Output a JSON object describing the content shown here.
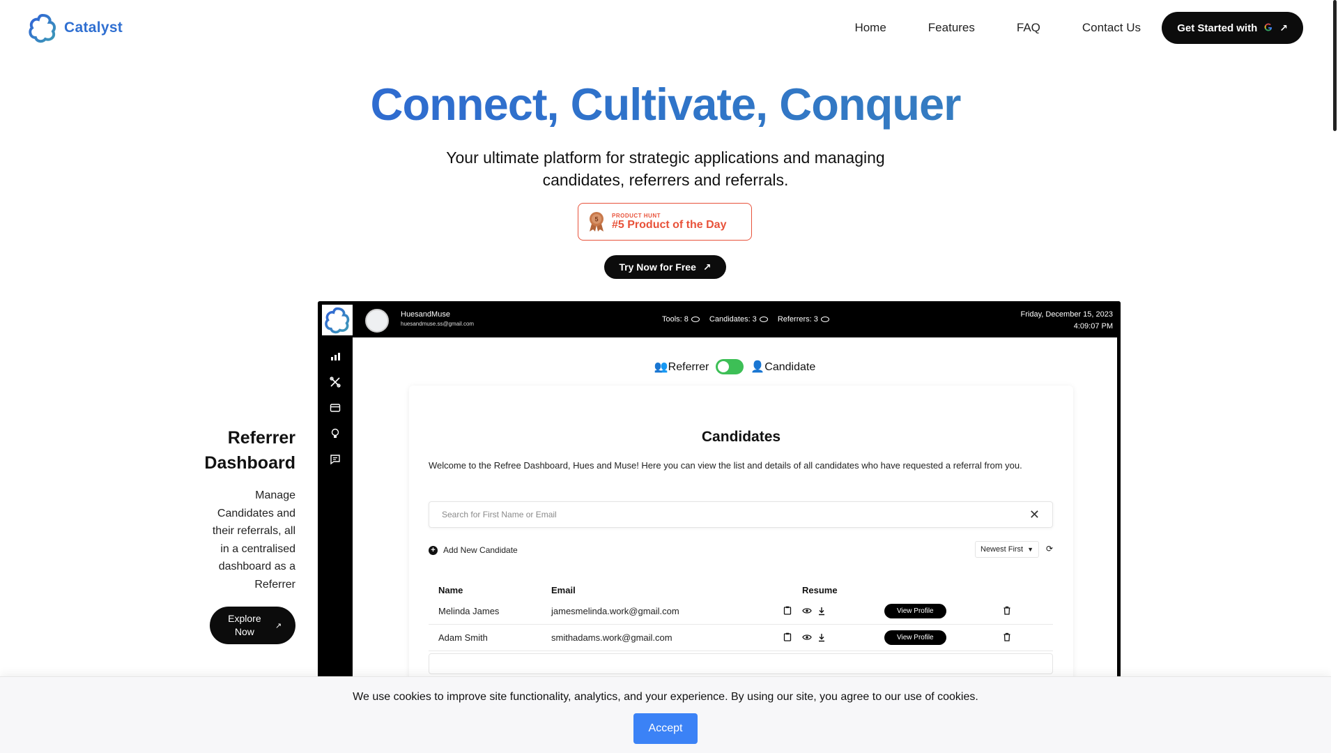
{
  "nav": {
    "brand": "Catalyst",
    "links": [
      "Home",
      "Features",
      "FAQ",
      "Contact Us"
    ],
    "cta_label": "Get Started with",
    "cta_icon": "google-icon"
  },
  "hero": {
    "title": "Connect, Cultivate, Conquer",
    "subtitle_line1": "Your ultimate platform for strategic applications and managing",
    "subtitle_line2": "candidates, referrers and referrals.",
    "badge_small": "PRODUCT HUNT",
    "badge_big": "#5 Product of the Day",
    "badge_rank": "5",
    "try_label": "Try Now for Free"
  },
  "feature": {
    "title": "Referrer Dashboard",
    "description": "Manage Candidates and their referrals, all in a centralised dashboard as a Referrer",
    "explore_label": "Explore Now"
  },
  "dashboard": {
    "user_name": "HuesandMuse",
    "user_email": "huesandmuse.ss@gmail.com",
    "stats": [
      "Tools: 8",
      "Candidates: 3",
      "Referrers: 3"
    ],
    "date": "Friday, December 15, 2023",
    "time": "4:09:07 PM",
    "toggle_left": "Referrer",
    "toggle_right": "Candidate",
    "card_title": "Candidates",
    "card_desc": "Welcome to the Refree Dashboard, Hues and Muse! Here you can view the list and details of all candidates who have requested a referral from you.",
    "search_placeholder": "Search for First Name or Email",
    "add_label": "Add New Candidate",
    "sort_label": "Newest First",
    "columns": [
      "Name",
      "Email",
      "Resume"
    ],
    "rows": [
      {
        "name": "Melinda James",
        "email": "jamesmelinda.work@gmail.com",
        "action": "View Profile"
      },
      {
        "name": "Adam Smith",
        "email": "smithadams.work@gmail.com",
        "action": "View Profile"
      }
    ]
  },
  "cookie": {
    "text": "We use cookies to improve site functionality, analytics, and your experience. By using our site, you agree to our use of cookies.",
    "accept_label": "Accept"
  },
  "colors": {
    "brand_blue": "#2f6fd1",
    "producthunt": "#e8523a",
    "toggle_green": "#3dbf56",
    "accept_blue": "#3b82f6"
  }
}
